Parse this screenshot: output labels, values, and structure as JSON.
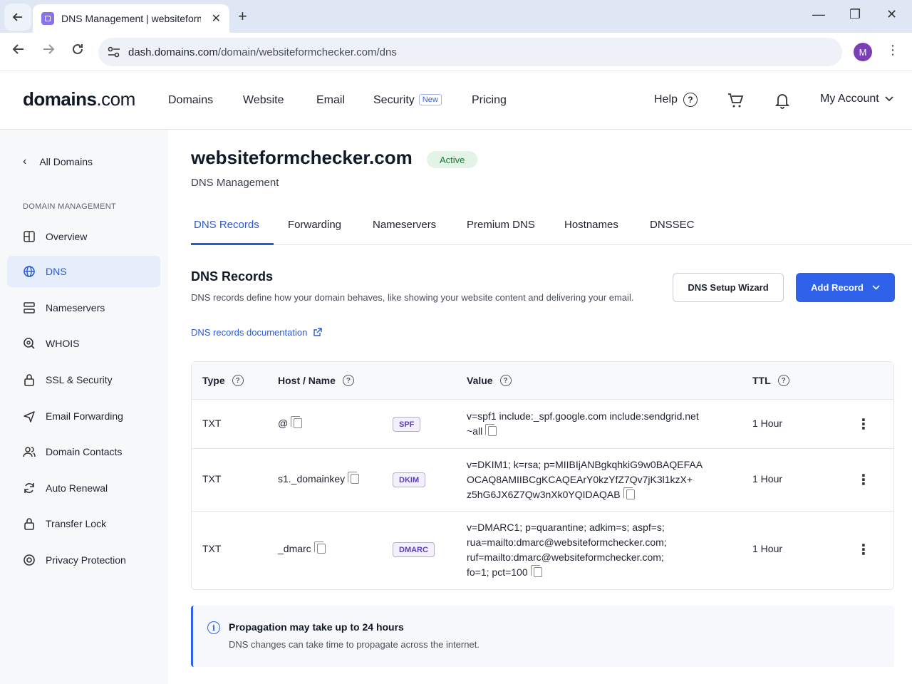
{
  "browser": {
    "tab_title": "DNS Management | websiteformchecker",
    "url_host": "dash.domains.com",
    "url_path": "/domain/websiteformchecker.com/dns",
    "profile_initial": "M"
  },
  "header": {
    "logo_main": "domains",
    "logo_suffix": ".com",
    "nav": [
      "Domains",
      "Website",
      "Email",
      "Security",
      "Pricing"
    ],
    "security_badge": "New",
    "help": "Help",
    "account": "My Account"
  },
  "sidebar": {
    "back_label": "All Domains",
    "section_label": "DOMAIN MANAGEMENT",
    "items": [
      {
        "label": "Overview",
        "icon": "overview-icon"
      },
      {
        "label": "DNS",
        "icon": "globe-icon"
      },
      {
        "label": "Nameservers",
        "icon": "server-icon"
      },
      {
        "label": "WHOIS",
        "icon": "whois-icon"
      },
      {
        "label": "SSL & Security",
        "icon": "lock-icon"
      },
      {
        "label": "Email Forwarding",
        "icon": "send-icon"
      },
      {
        "label": "Domain Contacts",
        "icon": "contacts-icon"
      },
      {
        "label": "Auto Renewal",
        "icon": "refresh-icon"
      },
      {
        "label": "Transfer Lock",
        "icon": "lock-icon"
      },
      {
        "label": "Privacy Protection",
        "icon": "shield-icon"
      }
    ],
    "active_index": 1
  },
  "page": {
    "domain": "websiteformchecker.com",
    "status": "Active",
    "subtitle": "DNS Management",
    "tabs": [
      "DNS Records",
      "Forwarding",
      "Nameservers",
      "Premium DNS",
      "Hostnames",
      "DNSSEC"
    ],
    "active_tab": 0
  },
  "records": {
    "title": "DNS Records",
    "description": "DNS records define how your domain behaves, like showing your website content and delivering your email.",
    "doc_link": "DNS records documentation",
    "wizard_button": "DNS Setup Wizard",
    "add_button": "Add Record",
    "columns": [
      "Type",
      "Host / Name",
      "Value",
      "TTL"
    ],
    "rows": [
      {
        "type": "TXT",
        "host": "@",
        "tag": "SPF",
        "value_lines": [
          "v=spf1 include:_spf.google.com include:sendgrid.net",
          "~all"
        ],
        "ttl": "1 Hour"
      },
      {
        "type": "TXT",
        "host": "s1._domainkey",
        "tag": "DKIM",
        "value_lines": [
          "v=DKIM1; k=rsa; p=MIIBIjANBgkqhkiG9w0BAQEFAA",
          "OCAQ8AMIIBCgKCAQEArY0kzYfZ7Qv7jK3l1kzX+",
          "z5hG6JX6Z7Qw3nXk0YQIDAQAB"
        ],
        "ttl": "1 Hour"
      },
      {
        "type": "TXT",
        "host": "_dmarc",
        "tag": "DMARC",
        "value_lines": [
          "v=DMARC1; p=quarantine; adkim=s; aspf=s;",
          "rua=mailto:dmarc@websiteformchecker.com;",
          "ruf=mailto:dmarc@websiteformchecker.com;",
          "fo=1; pct=100"
        ],
        "ttl": "1 Hour"
      }
    ]
  },
  "callout": {
    "title": "Propagation may take up to 24 hours",
    "description": "DNS changes can take time to propagate across the internet."
  },
  "colors": {
    "accent": "#2f62e8",
    "active_pill_bg": "#e4f3e7",
    "tag_bg": "#f3effc"
  }
}
